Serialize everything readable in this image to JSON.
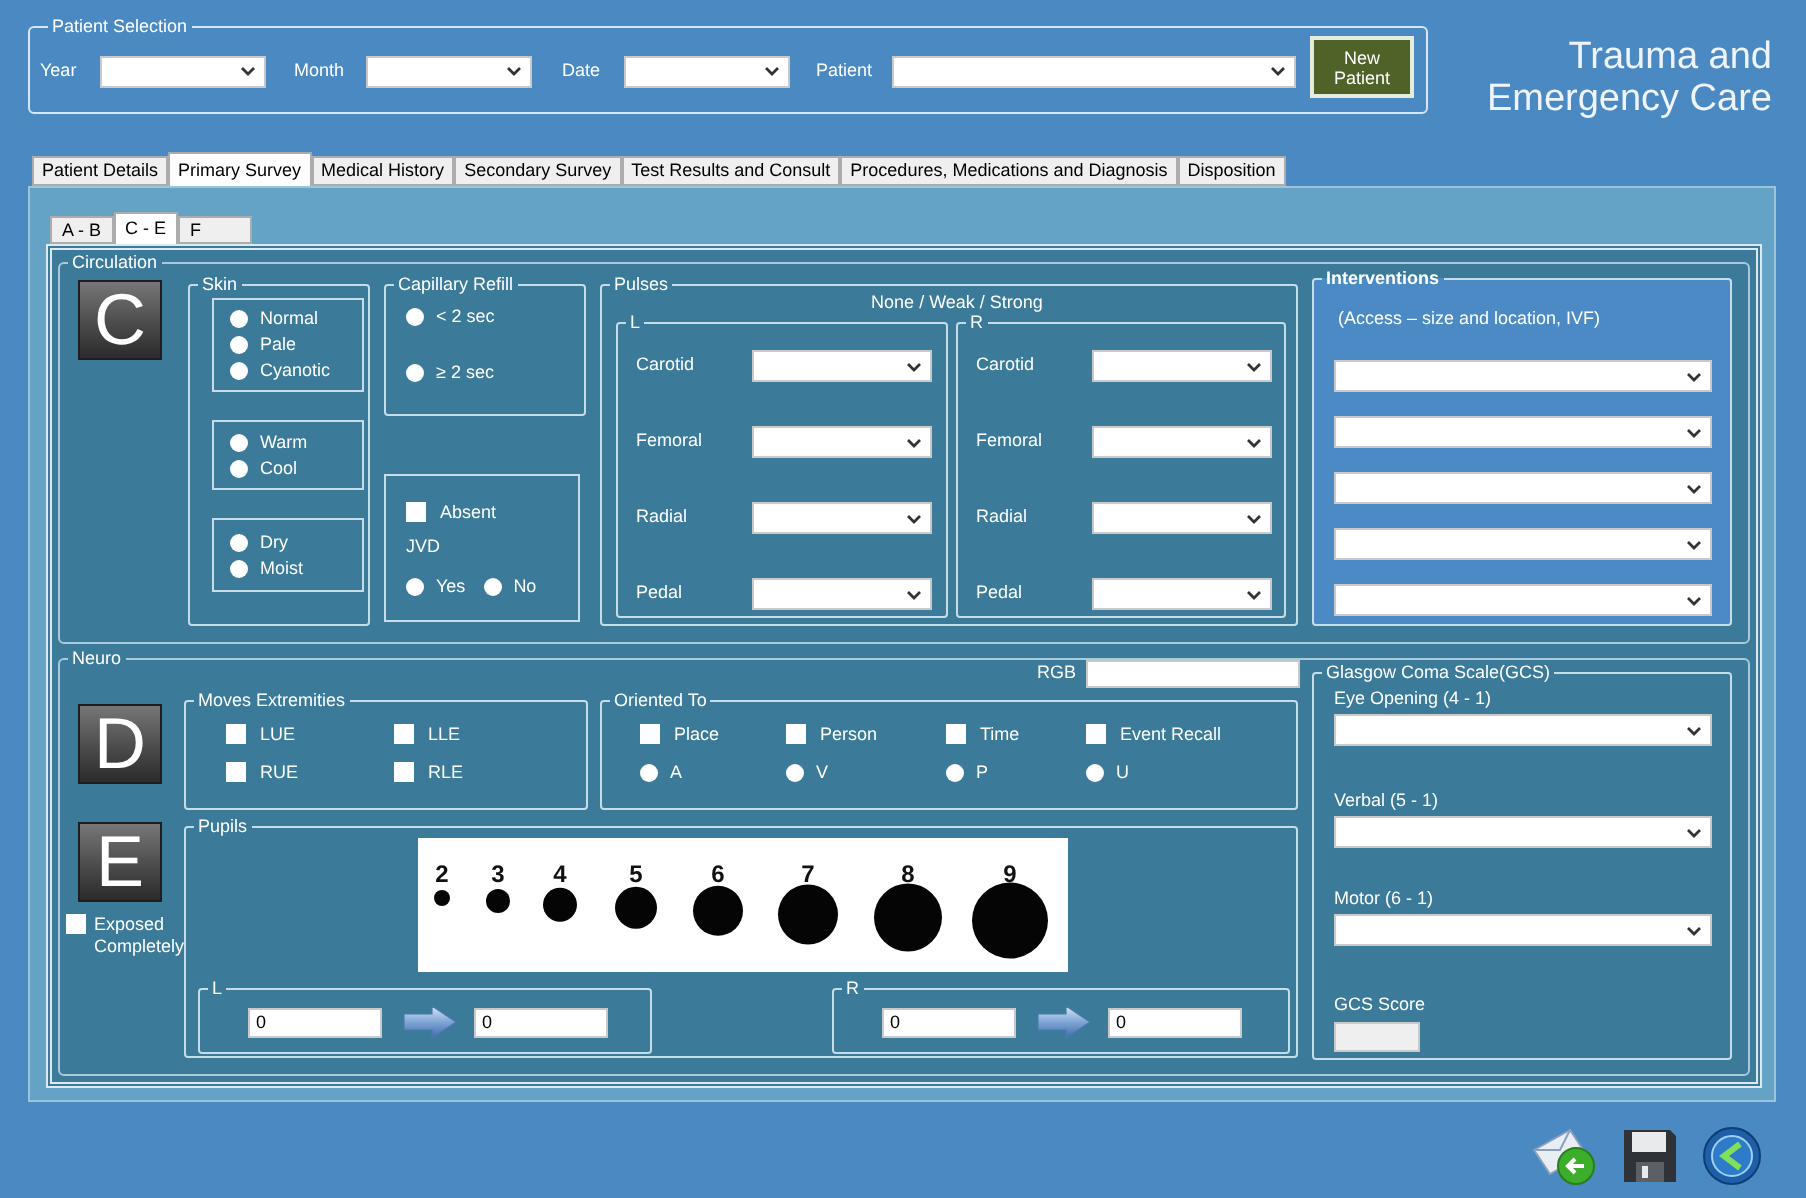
{
  "patient_selection": {
    "title": "Patient Selection",
    "fields": [
      {
        "label": "Year"
      },
      {
        "label": "Month"
      },
      {
        "label": "Date"
      },
      {
        "label": "Patient"
      }
    ],
    "new_patient_button": "New Patient"
  },
  "app_title": "Trauma and Emergency Care",
  "tabs": [
    {
      "label": "Patient Details",
      "selected": false
    },
    {
      "label": "Primary Survey",
      "selected": true
    },
    {
      "label": "Medical History",
      "selected": false
    },
    {
      "label": "Secondary Survey",
      "selected": false
    },
    {
      "label": "Test Results and Consult",
      "selected": false
    },
    {
      "label": "Procedures, Medications and Diagnosis",
      "selected": false
    },
    {
      "label": "Disposition",
      "selected": false
    }
  ],
  "sub_tabs": [
    {
      "label": "A - B",
      "selected": false
    },
    {
      "label": "C - E",
      "selected": true
    },
    {
      "label": "F",
      "selected": false
    }
  ],
  "circulation": {
    "title": "Circulation",
    "badge": "C",
    "skin": {
      "title": "Skin",
      "groups": [
        {
          "options": [
            {
              "label": "Normal",
              "selected": false
            },
            {
              "label": "Pale",
              "selected": false
            },
            {
              "label": "Cyanotic",
              "selected": false
            }
          ]
        },
        {
          "options": [
            {
              "label": "Warm",
              "selected": false
            },
            {
              "label": "Cool",
              "selected": false
            }
          ]
        },
        {
          "options": [
            {
              "label": "Dry",
              "selected": false
            },
            {
              "label": "Moist",
              "selected": false
            }
          ]
        }
      ]
    },
    "capillary_refill": {
      "title": "Capillary Refill",
      "options": [
        {
          "label": "< 2 sec",
          "selected": false
        },
        {
          "label": "≥ 2 sec",
          "selected": false
        }
      ]
    },
    "jvd": {
      "absent": {
        "label": "Absent",
        "checked": false
      },
      "label": "JVD",
      "options": [
        {
          "label": "Yes",
          "selected": false
        },
        {
          "label": "No",
          "selected": false
        }
      ]
    },
    "pulses": {
      "title": "Pulses",
      "scale": "None / Weak / Strong",
      "sides": [
        {
          "label": "L",
          "sites": [
            "Carotid",
            "Femoral",
            "Radial",
            "Pedal"
          ]
        },
        {
          "label": "R",
          "sites": [
            "Carotid",
            "Femoral",
            "Radial",
            "Pedal"
          ]
        }
      ]
    },
    "interventions": {
      "title": "Interventions",
      "hint": "(Access – size and location, IVF)"
    }
  },
  "neuro": {
    "title": "Neuro",
    "rgb_label": "RGB",
    "d_badge": "D",
    "moves_extremities": {
      "title": "Moves Extremities",
      "items": [
        {
          "label": "LUE",
          "checked": false
        },
        {
          "label": "LLE",
          "checked": false
        },
        {
          "label": "RUE",
          "checked": false
        },
        {
          "label": "RLE",
          "checked": false
        }
      ]
    },
    "oriented_to": {
      "title": "Oriented To",
      "items": [
        {
          "label": "Place",
          "checked": false
        },
        {
          "label": "Person",
          "checked": false
        },
        {
          "label": "Time",
          "checked": false
        },
        {
          "label": "Event Recall",
          "checked": false
        }
      ],
      "avpu": [
        {
          "label": "A",
          "selected": false
        },
        {
          "label": "V",
          "selected": false
        },
        {
          "label": "P",
          "selected": false
        },
        {
          "label": "U",
          "selected": false
        }
      ]
    },
    "e_badge": "E",
    "exposed_completely": {
      "label": "Exposed Completely",
      "checked": false
    },
    "pupils": {
      "title": "Pupils",
      "scale": [
        "2",
        "3",
        "4",
        "5",
        "6",
        "7",
        "8",
        "9"
      ],
      "sides": [
        {
          "label": "L",
          "from": "0",
          "to": "0"
        },
        {
          "label": "R",
          "from": "0",
          "to": "0"
        }
      ]
    }
  },
  "gcs": {
    "title": "Glasgow Coma Scale(GCS)",
    "fields": [
      {
        "label": "Eye Opening (4 - 1)"
      },
      {
        "label": "Verbal (5 - 1)"
      },
      {
        "label": "Motor (6 - 1)"
      }
    ],
    "score_label": "GCS Score"
  }
}
